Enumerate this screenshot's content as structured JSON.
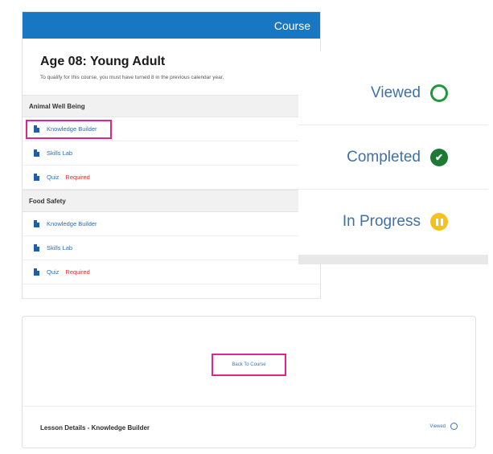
{
  "course": {
    "header_title": "Course",
    "title": "Age 08: Young Adult",
    "description": "To qualify for this course, you must have turned 8 in the previous calendar year.",
    "sections": [
      {
        "name": "Animal Well Being",
        "lessons": [
          {
            "label": "Knowledge Builder",
            "required": ""
          },
          {
            "label": "Skills Lab",
            "required": ""
          },
          {
            "label": "Quiz",
            "required": "Required"
          }
        ]
      },
      {
        "name": "Food Safety",
        "lessons": [
          {
            "label": "Knowledge Builder",
            "required": ""
          },
          {
            "label": "Skills Lab",
            "required": ""
          },
          {
            "label": "Quiz",
            "required": "Required"
          }
        ]
      }
    ]
  },
  "status_legend": {
    "viewed": "Viewed",
    "completed": "Completed",
    "in_progress": "In Progress"
  },
  "lesson_details": {
    "back_label": "Back To Course",
    "title": "Lesson Details - Knowledge Builder",
    "status": "Viewed"
  },
  "colors": {
    "header_blue": "#1877c2",
    "highlight_pink": "#e0268a",
    "link_blue": "#2a6db5",
    "required_red": "#d3312f",
    "viewed_green": "#1f9a3a",
    "completed_green": "#1c7a35",
    "progress_yellow": "#f5c21a"
  },
  "icons": {
    "lesson": "document-icon",
    "viewed": "circle-outline-icon",
    "completed": "check-circle-icon",
    "in_progress": "pause-circle-icon"
  }
}
